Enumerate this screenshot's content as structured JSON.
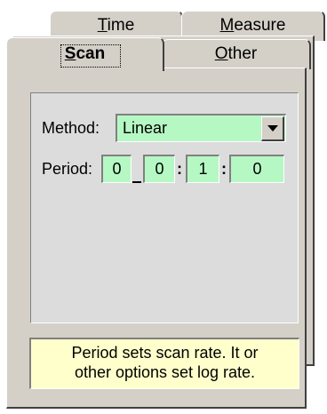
{
  "tabs": {
    "back_row": [
      {
        "label": "Time"
      },
      {
        "label": "Measure"
      }
    ],
    "front_row": [
      {
        "label": "Scan",
        "selected": true
      },
      {
        "label": "Other"
      }
    ]
  },
  "scan": {
    "method_label": "Method:",
    "method_value": "Linear",
    "period_label": "Period:",
    "period_fields": [
      "0",
      "0",
      "1",
      "0"
    ],
    "separator": ":"
  },
  "hint": {
    "line1": "Period sets scan rate. It or",
    "line2": "other options set log rate."
  },
  "colors": {
    "face": "#d4d0c8",
    "field_bg": "#b6f8c4",
    "hint_bg": "#ffffcc"
  },
  "icons": {
    "dropdown": "chevron-down-icon"
  }
}
